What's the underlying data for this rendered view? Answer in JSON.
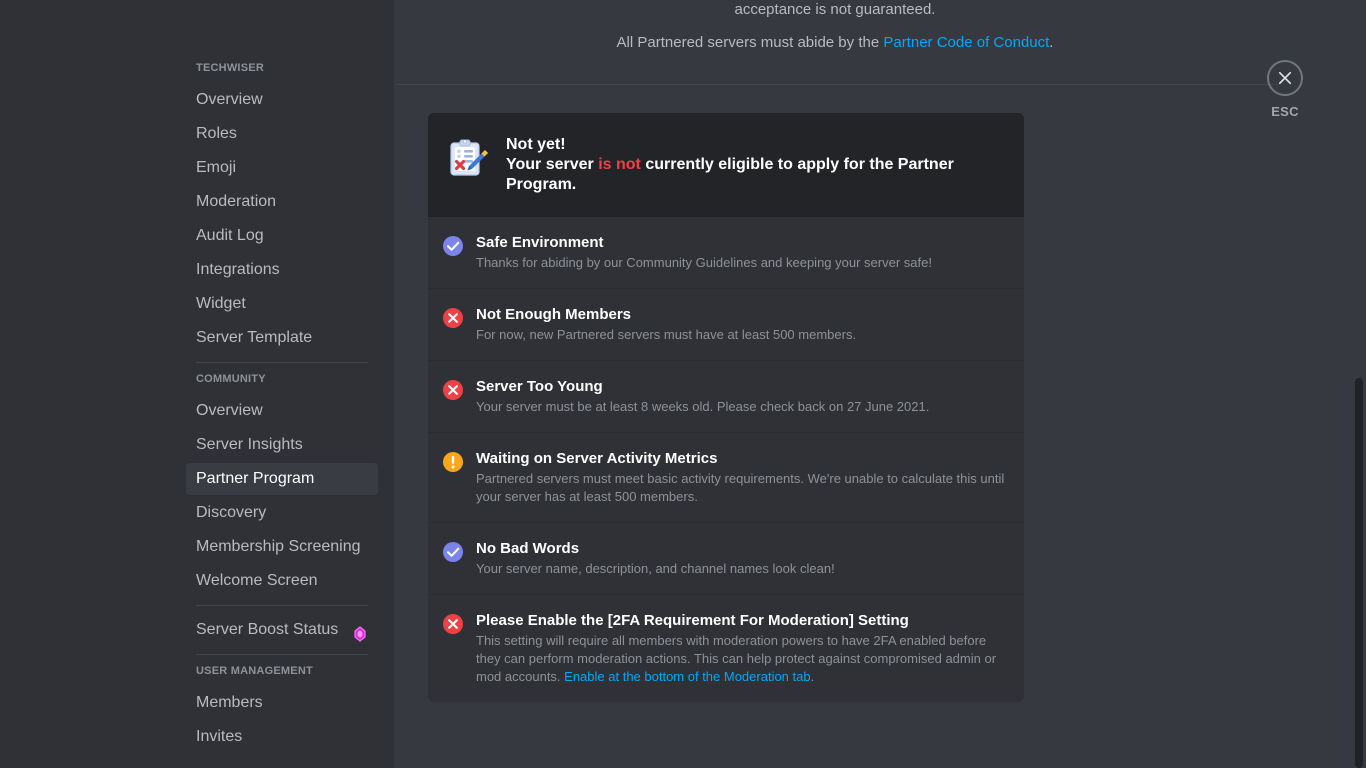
{
  "sidebar": {
    "sections": [
      {
        "header": "TECHWISER",
        "items": [
          {
            "label": "Overview",
            "selected": false
          },
          {
            "label": "Roles",
            "selected": false
          },
          {
            "label": "Emoji",
            "selected": false
          },
          {
            "label": "Moderation",
            "selected": false
          },
          {
            "label": "Audit Log",
            "selected": false
          },
          {
            "label": "Integrations",
            "selected": false
          },
          {
            "label": "Widget",
            "selected": false
          },
          {
            "label": "Server Template",
            "selected": false
          }
        ]
      },
      {
        "header": "COMMUNITY",
        "items": [
          {
            "label": "Overview",
            "selected": false
          },
          {
            "label": "Server Insights",
            "selected": false
          },
          {
            "label": "Partner Program",
            "selected": true
          },
          {
            "label": "Discovery",
            "selected": false
          },
          {
            "label": "Membership Screening",
            "selected": false
          },
          {
            "label": "Welcome Screen",
            "selected": false
          }
        ]
      },
      {
        "header": "",
        "items": [
          {
            "label": "Server Boost Status",
            "selected": false,
            "icon": "boost-gem-icon"
          }
        ]
      },
      {
        "header": "USER MANAGEMENT",
        "items": [
          {
            "label": "Members",
            "selected": false
          },
          {
            "label": "Invites",
            "selected": false
          }
        ]
      }
    ]
  },
  "intro": {
    "clipped_line": "apply at any time, and we will review your application, but acceptance is not guaranteed.",
    "line2": "acceptance is not guaranteed.",
    "line3_prefix": "All Partnered servers must abide by the ",
    "line3_link": "Partner Code of Conduct",
    "line3_suffix": "."
  },
  "card": {
    "header": {
      "icon": "clipboard-x-pencil-icon",
      "title": "Not yet!",
      "body_prefix": "Your server ",
      "body_emphasis": "is not",
      "body_suffix": " currently eligible to apply for the Partner Program."
    },
    "rows": [
      {
        "status": "pass",
        "icon": "check-circle-icon",
        "title": "Safe Environment",
        "desc": "Thanks for abiding by our Community Guidelines and keeping your server safe!"
      },
      {
        "status": "fail",
        "icon": "x-circle-icon",
        "title": "Not Enough Members",
        "desc": "For now, new Partnered servers must have at least 500 members."
      },
      {
        "status": "fail",
        "icon": "x-circle-icon",
        "title": "Server Too Young",
        "desc": "Your server must be at least 8 weeks old. Please check back on 27 June 2021."
      },
      {
        "status": "warn",
        "icon": "warning-circle-icon",
        "title": "Waiting on Server Activity Metrics",
        "desc": "Partnered servers must meet basic activity requirements. We're unable to calculate this until your server has at least 500 members."
      },
      {
        "status": "pass",
        "icon": "check-circle-icon",
        "title": "No Bad Words",
        "desc": "Your server name, description, and channel names look clean!"
      },
      {
        "status": "fail",
        "icon": "x-circle-icon",
        "title": "Please Enable the [2FA Requirement For Moderation] Setting",
        "desc": "This setting will require all members with moderation powers to have 2FA enabled before they can perform moderation actions. This can help protect against compromised admin or mod accounts. ",
        "desc_link": "Enable at the bottom of the Moderation tab",
        "desc_suffix": "."
      }
    ]
  },
  "close": {
    "icon": "close-x-icon",
    "label": "ESC"
  },
  "colors": {
    "sidebar_bg": "#2f3136",
    "content_bg": "#36393f",
    "card_header_bg": "#232428",
    "accent_blurple": "#7b84eb",
    "danger_red": "#ed4245",
    "warning_orange": "#faa61a",
    "link_blue": "#00a8fc",
    "boost_pink": "#ff73fa",
    "selected_bg": "#393c43"
  }
}
